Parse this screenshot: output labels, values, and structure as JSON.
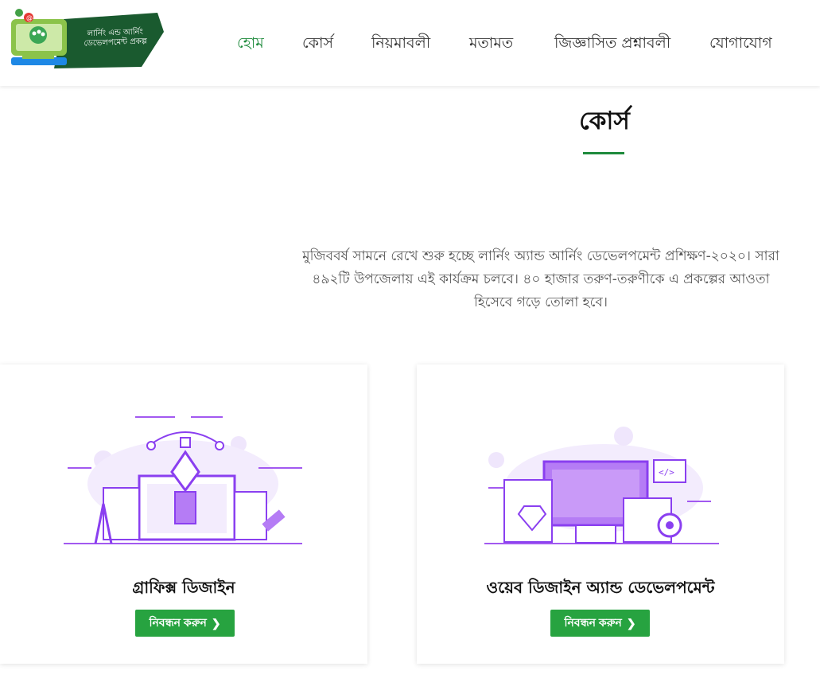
{
  "header": {
    "logo_text_line1": "লার্নিং এন্ড আর্নিং",
    "logo_text_line2": "ডেভেলপমেন্ট প্রকল্প",
    "nav": [
      {
        "label": "হোম"
      },
      {
        "label": "কোর্স"
      },
      {
        "label": "নিয়মাবলী"
      },
      {
        "label": "মতামত"
      },
      {
        "label": "জিজ্ঞাসিত প্রশ্নাবলী"
      },
      {
        "label": "যোগাযোগ"
      }
    ]
  },
  "main": {
    "section_title": "কোর্স",
    "intro": "মুজিববর্ষ সামনে রেখে শুরু হচ্ছে লার্নিং অ্যান্ড আর্নিং ডেভেলপমেন্ট প্রশিক্ষণ-২০২০। সারা\n৪৯২টি উপজেলায় এই কার্যক্রম চলবে। ৪০ হাজার তরুণ-তরুণীকে এ প্রকল্পের আওতা\nহিসেবে গড়ে তোলা হবে।",
    "cards": [
      {
        "title": "গ্রাফিক্স ডিজাইন",
        "button": "নিবন্ধন করুন",
        "icon": "graphic-design-illustration"
      },
      {
        "title": "ওয়েব ডিজাইন অ্যান্ড ডেভেলপমেন্ট",
        "button": "নিবন্ধন করুন",
        "icon": "web-design-illustration"
      }
    ]
  },
  "colors": {
    "accent": "#1e8a3c",
    "button": "#27a340",
    "illustration": "#a259f0"
  }
}
